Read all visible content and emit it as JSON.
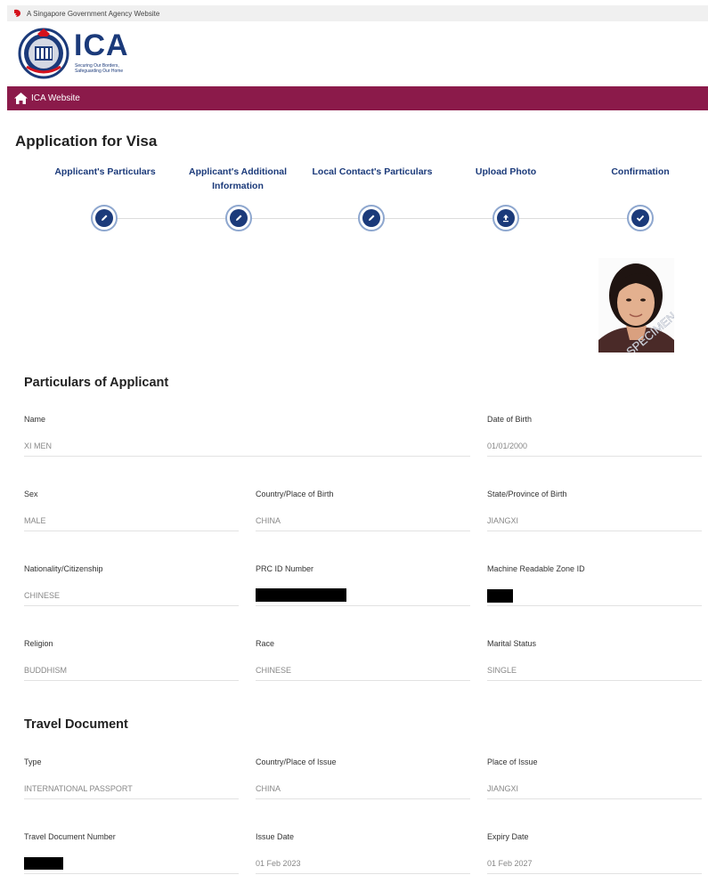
{
  "gov_bar": {
    "text": "A Singapore Government Agency Website"
  },
  "logo": {
    "text": "ICA",
    "tagline_line1": "Securing Our Borders,",
    "tagline_line2": "Safeguarding Our Home"
  },
  "nav": {
    "home_label": "ICA Website"
  },
  "page_title": "Application for Visa",
  "steps": [
    {
      "line1": "Applicant's Particulars",
      "line2": ""
    },
    {
      "line1": "Applicant's Additional",
      "line2": "Information"
    },
    {
      "line1": "Local Contact's Particulars",
      "line2": ""
    },
    {
      "line1": "Upload Photo",
      "line2": ""
    },
    {
      "line1": "Confirmation",
      "line2": ""
    }
  ],
  "photo": {
    "watermark": "SPECIMEN"
  },
  "particulars": {
    "title": "Particulars of Applicant",
    "name": {
      "label": "Name",
      "value": "XI MEN"
    },
    "dob": {
      "label": "Date of Birth",
      "value": "01/01/2000"
    },
    "sex": {
      "label": "Sex",
      "value": "MALE"
    },
    "country_birth": {
      "label": "Country/Place of Birth",
      "value": "CHINA"
    },
    "state_birth": {
      "label": "State/Province of Birth",
      "value": "JIANGXI"
    },
    "nationality": {
      "label": "Nationality/Citizenship",
      "value": "CHINESE"
    },
    "prc_id": {
      "label": "PRC ID Number",
      "value": ""
    },
    "mrz_id": {
      "label": "Machine Readable Zone ID",
      "value": ""
    },
    "religion": {
      "label": "Religion",
      "value": "BUDDHISM"
    },
    "race": {
      "label": "Race",
      "value": "CHINESE"
    },
    "marital": {
      "label": "Marital Status",
      "value": "SINGLE"
    }
  },
  "travel": {
    "title": "Travel Document",
    "type": {
      "label": "Type",
      "value": "INTERNATIONAL PASSPORT"
    },
    "country_issue": {
      "label": "Country/Place of Issue",
      "value": "CHINA"
    },
    "place_issue": {
      "label": "Place of Issue",
      "value": "JIANGXI"
    },
    "doc_number": {
      "label": "Travel Document Number",
      "value": ""
    },
    "issue_date": {
      "label": "Issue Date",
      "value": "01 Feb 2023"
    },
    "expiry_date": {
      "label": "Expiry Date",
      "value": "01 Feb 2027"
    }
  },
  "colors": {
    "brand_navy": "#1b3a7a",
    "nav_maroon": "#8b1a4a",
    "step_ring": "#8ea7cf"
  },
  "icons": [
    "lion-head-icon",
    "ica-crest-icon",
    "home-icon",
    "edit-icon",
    "upload-icon",
    "check-icon"
  ]
}
